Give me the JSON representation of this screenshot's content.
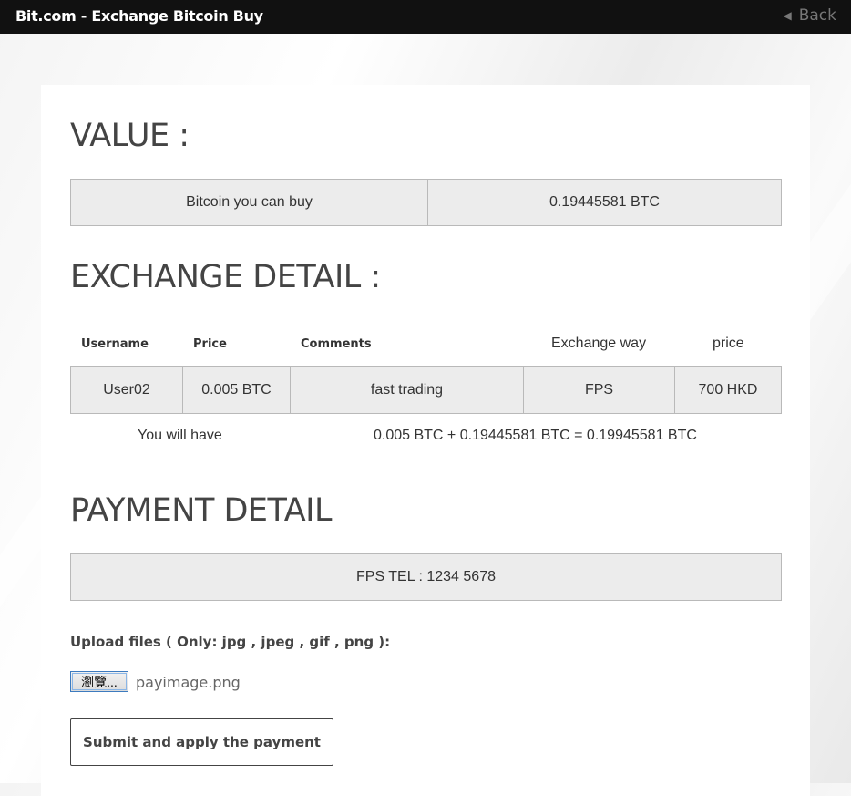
{
  "header": {
    "title": "Bit.com - Exchange Bitcoin Buy",
    "back_label": "Back",
    "back_icon": "◀"
  },
  "value_section": {
    "heading": "VALUE :",
    "label": "Bitcoin you can buy",
    "amount": "0.19445581 BTC"
  },
  "exchange_section": {
    "heading": "EXCHANGE DETAIL :",
    "columns": [
      "Username",
      "Price",
      "Comments",
      "Exchange way",
      "price"
    ],
    "row": [
      "User02",
      "0.005 BTC",
      "fast trading",
      "FPS",
      "700 HKD"
    ],
    "result_label": "You will have",
    "result_value": "0.005 BTC + 0.19445581 BTC = 0.19945581 BTC"
  },
  "payment_section": {
    "heading": "PAYMENT DETAIL",
    "info": "FPS TEL : 1234 5678",
    "upload_label": "Upload files ( Only: jpg , jpeg , gif , png ):",
    "browse_label": "瀏覽...",
    "file_name": "payimage.png",
    "submit_label": "Submit and apply the payment"
  }
}
